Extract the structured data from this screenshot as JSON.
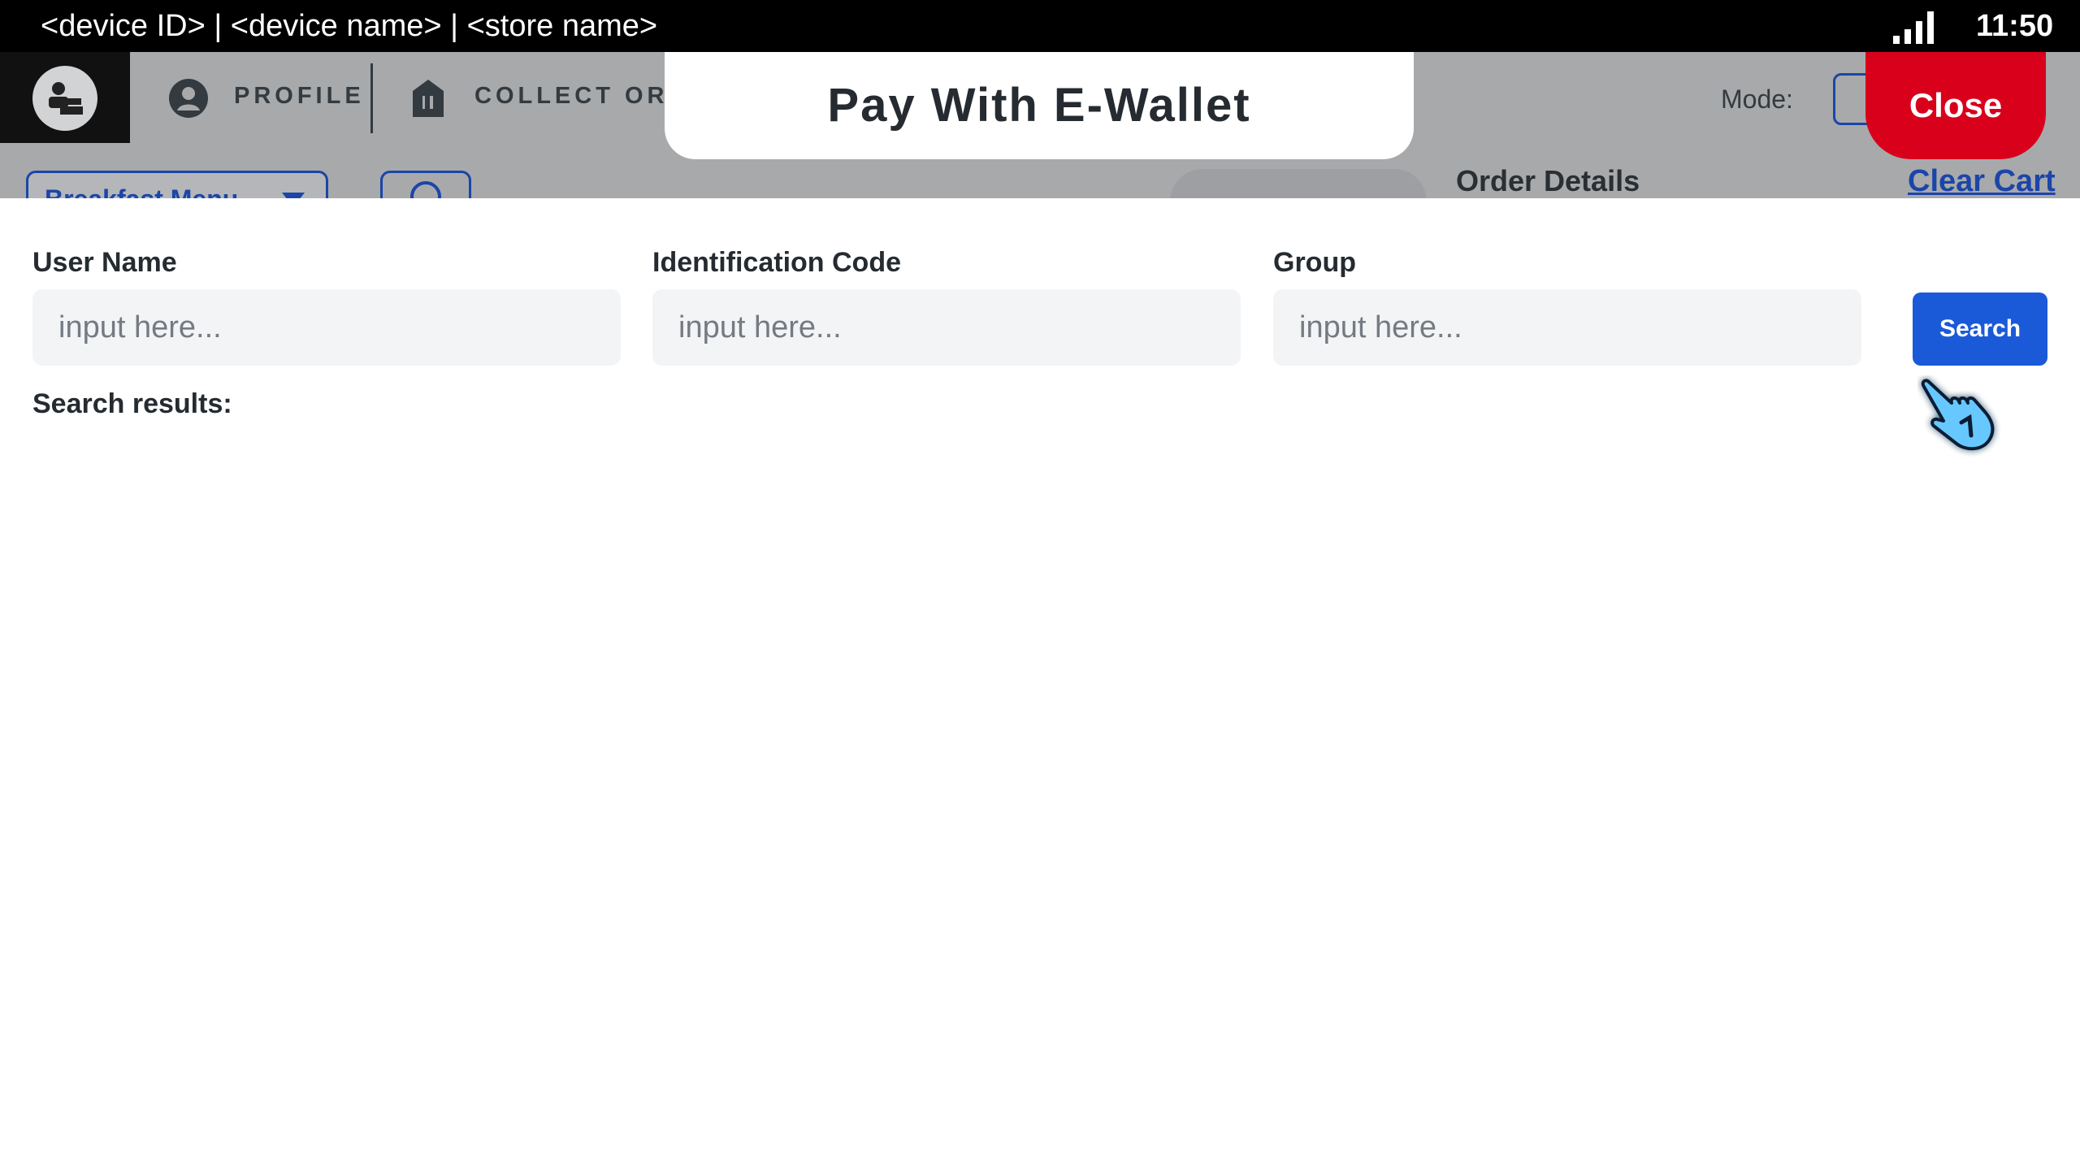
{
  "status_bar": {
    "device_info": "<device ID> | <device name> | <store name>",
    "time": "11:50"
  },
  "app_header": {
    "nav": [
      {
        "label": "PROFILE",
        "icon": "user-circle-icon"
      },
      {
        "label": "COLLECT ORDE",
        "icon": "food-bag-icon"
      }
    ],
    "mode_label": "Mode:",
    "menu_dropdown": "Breakfast Menu",
    "order_details": "Order Details",
    "clear_cart": "Clear Cart"
  },
  "modal": {
    "title": "Pay With E-Wallet",
    "close_label": "Close",
    "fields": [
      {
        "label": "User Name",
        "placeholder": "input here..."
      },
      {
        "label": "Identification Code",
        "placeholder": "input here..."
      },
      {
        "label": "Group",
        "placeholder": "input here..."
      }
    ],
    "search_label": "Search",
    "results_label": "Search results:"
  },
  "colors": {
    "close": "#d9001b",
    "primary": "#1a5ad8",
    "overlay_gray": "#a7a9ab"
  }
}
